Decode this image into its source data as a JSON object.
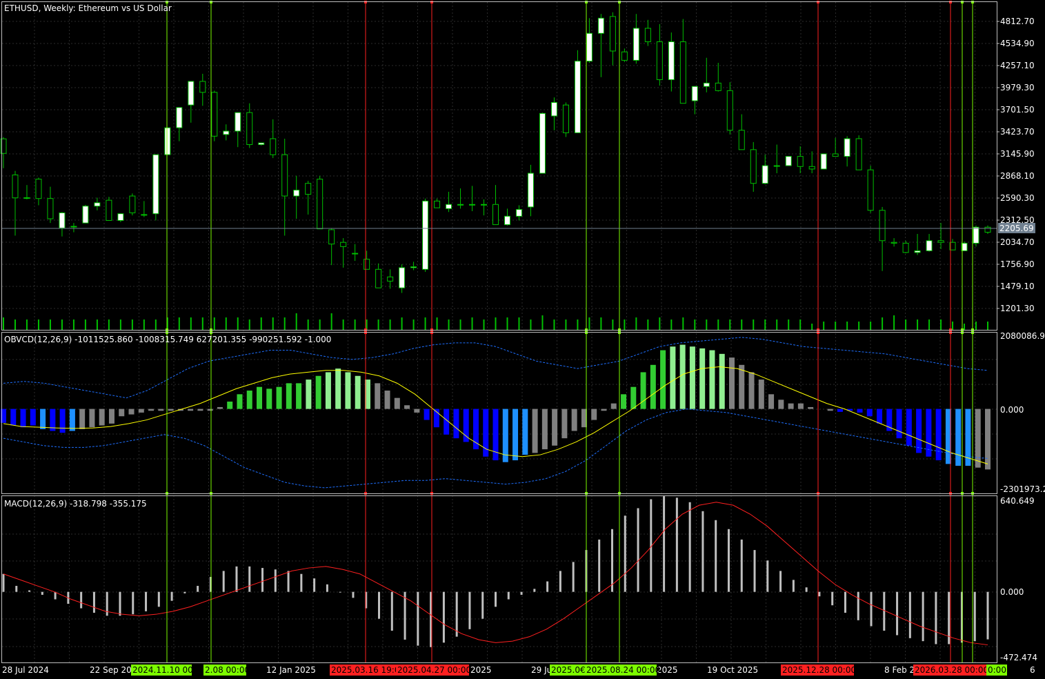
{
  "window": {
    "title": "ETHUSD, Weekly:  Ethereum vs US Dollar",
    "current_price": "2205.69"
  },
  "colors": {
    "background": "#000000",
    "grid": "#c0c0c0",
    "text": "#ffffff",
    "axis": "#c0c0c0",
    "bull_candle": "#ffffff",
    "bear_candle": "#000000",
    "wick": "#00c000",
    "volume": "#00c000",
    "buy_line": "#7cfc00",
    "sell_line": "#ff2020",
    "price_line": "#708090",
    "obv_bright_green": "#32cd32",
    "obv_light_green": "#90ee90",
    "obv_gray": "#808080",
    "obv_blue": "#0000ff",
    "obv_light_blue": "#1e90ff",
    "obv_signal": "#ffff00",
    "obv_band": "#1e6fff",
    "macd_hist": "#c0c0c0",
    "macd_signal": "#ff2020"
  },
  "price_axis": {
    "labels": [
      "4812.70",
      "4534.90",
      "4257.10",
      "3979.30",
      "3701.50",
      "3423.70",
      "3145.90",
      "2868.10",
      "2590.30",
      "2312.50",
      "2034.70",
      "1756.90",
      "1479.10",
      "1201.30"
    ]
  },
  "obvcd": {
    "label": "OBVCD(12,26,9) -1011525.860 -1008315.749 627201.355 -990251.592 -1.000",
    "axis_top": "2080086.98",
    "axis_zero": "0.000",
    "axis_bottom": "-2301973.2"
  },
  "macd": {
    "label": "MACD(12,26,9) -318.798 -355.175",
    "axis_top": "640.649",
    "axis_zero": "0.000",
    "axis_bottom": "-472.474"
  },
  "time_axis": {
    "labels": [
      "28 Jul 2024",
      "22 Sep 20",
      "12 Jan 2025",
      "2025",
      "29 Ju",
      "2025",
      "19 Oct 2025",
      "8 Feb 2",
      "6"
    ],
    "tags": [
      {
        "text": "2024.11.10 00:00",
        "type": "buy"
      },
      {
        "text": "2.08 00:00",
        "type": "buy"
      },
      {
        "text": "2025.03.16 19:0",
        "type": "sell"
      },
      {
        "text": "2025.04.27 00:00",
        "type": "sell"
      },
      {
        "text": "2025.0€",
        "type": "buy"
      },
      {
        "text": "2025.08.24 00:00",
        "type": "buy"
      },
      {
        "text": "2025.12.28 00:00",
        "type": "sell"
      },
      {
        "text": "2026.03.28 00:00",
        "type": "sell"
      },
      {
        "text": "0:00",
        "type": "buy"
      }
    ]
  },
  "chart_data": [
    {
      "type": "candlestick",
      "title": "ETHUSD, Weekly:  Ethereum vs US Dollar",
      "ylim": [
        1062,
        4951
      ],
      "ohlc": [
        [
          3328,
          3348,
          2980,
          3156
        ],
        [
          2900,
          2948,
          2180,
          2628
        ],
        [
          2628,
          2780,
          2610,
          2630
        ],
        [
          2850,
          2868,
          2540,
          2620
        ],
        [
          2620,
          2760,
          2330,
          2380
        ],
        [
          2270,
          2460,
          2170,
          2450
        ],
        [
          2290,
          2330,
          2220,
          2290
        ],
        [
          2330,
          2545,
          2330,
          2530
        ],
        [
          2530,
          2630,
          2480,
          2570
        ],
        [
          2600,
          2640,
          2370,
          2360
        ],
        [
          2360,
          2425,
          2340,
          2440
        ],
        [
          2650,
          2680,
          2420,
          2450
        ],
        [
          2430,
          2590,
          2400,
          2430
        ],
        [
          2440,
          3140,
          2360,
          3140
        ],
        [
          3140,
          3230,
          3140,
          3460
        ],
        [
          3460,
          3680,
          3300,
          3700
        ],
        [
          3730,
          3980,
          3520,
          4010
        ],
        [
          4010,
          4100,
          3720,
          3880
        ],
        [
          3880,
          3900,
          3300,
          3360
        ],
        [
          3380,
          3500,
          3310,
          3420
        ],
        [
          3420,
          3630,
          3230,
          3640
        ],
        [
          3640,
          3750,
          3220,
          3260
        ],
        [
          3260,
          3270,
          3250,
          3280
        ],
        [
          3330,
          3560,
          3100,
          3140
        ],
        [
          3140,
          3330,
          2180,
          2650
        ],
        [
          2650,
          2890,
          2380,
          2720
        ],
        [
          2800,
          2830,
          2430,
          2670
        ],
        [
          2850,
          2890,
          2520,
          2260
        ],
        [
          2250,
          2270,
          1830,
          2080
        ],
        [
          2100,
          2150,
          1800,
          2050
        ],
        [
          1970,
          2080,
          1880,
          1970
        ],
        [
          1900,
          2000,
          1840,
          1780
        ],
        [
          1780,
          1850,
          1640,
          1560
        ],
        [
          1690,
          1780,
          1550,
          1640
        ],
        [
          1560,
          1840,
          1500,
          1800
        ],
        [
          1800,
          1870,
          1770,
          1810
        ],
        [
          1780,
          2620,
          1750,
          2590
        ],
        [
          2590,
          2620,
          2510,
          2510
        ],
        [
          2500,
          2700,
          2460,
          2550
        ],
        [
          2550,
          2740,
          2500,
          2550
        ],
        [
          2550,
          2770,
          2470,
          2550
        ],
        [
          2550,
          2610,
          2420,
          2550
        ],
        [
          2550,
          2780,
          2350,
          2310
        ],
        [
          2310,
          2500,
          2300,
          2410
        ],
        [
          2410,
          2540,
          2360,
          2490
        ],
        [
          2520,
          3020,
          2410,
          2920
        ],
        [
          2920,
          3640,
          3000,
          3630
        ],
        [
          3600,
          3820,
          3430,
          3760
        ],
        [
          3730,
          3760,
          3350,
          3400
        ],
        [
          3400,
          4380,
          3410,
          4250
        ],
        [
          4250,
          4760,
          4230,
          4580
        ],
        [
          4580,
          4810,
          4060,
          4760
        ],
        [
          4780,
          4830,
          4200,
          4370
        ],
        [
          4360,
          4400,
          4240,
          4260
        ],
        [
          4260,
          4810,
          4220,
          4640
        ],
        [
          4640,
          4740,
          4430,
          4480
        ],
        [
          4480,
          4690,
          3960,
          4030
        ],
        [
          4030,
          4590,
          3890,
          4480
        ],
        [
          4480,
          4750,
          4050,
          3750
        ],
        [
          3780,
          3790,
          3620,
          3950
        ],
        [
          3950,
          4290,
          3880,
          3990
        ],
        [
          3990,
          4230,
          3890,
          3900
        ],
        [
          3900,
          4000,
          3380,
          3430
        ],
        [
          3430,
          3620,
          3280,
          3200
        ],
        [
          3200,
          3290,
          2700,
          2800
        ],
        [
          2800,
          3140,
          2790,
          3010
        ],
        [
          3010,
          3260,
          2920,
          3010
        ],
        [
          3010,
          3120,
          3020,
          3120
        ],
        [
          3120,
          3240,
          2920,
          3000
        ],
        [
          3000,
          3180,
          2920,
          2970
        ],
        [
          2970,
          3140,
          3000,
          3150
        ],
        [
          3150,
          3340,
          3130,
          3120
        ],
        [
          3120,
          3360,
          3000,
          3330
        ],
        [
          3330,
          3370,
          3090,
          2960
        ],
        [
          2960,
          3010,
          2450,
          2480
        ],
        [
          2480,
          2520,
          1760,
          2120
        ],
        [
          2100,
          2150,
          2050,
          2090
        ],
        [
          2090,
          2120,
          1970,
          1980
        ],
        [
          1980,
          2200,
          1950,
          2000
        ],
        [
          2000,
          2200,
          1990,
          2120
        ],
        [
          2120,
          2330,
          2020,
          2100
        ],
        [
          2100,
          2140,
          2010,
          2010
        ],
        [
          2000,
          2110,
          2010,
          2090
        ],
        [
          2090,
          2300,
          2050,
          2280
        ],
        [
          2280,
          2300,
          2200,
          2220
        ]
      ],
      "volume_relative": [
        0.6,
        0.5,
        0.5,
        0.5,
        0.5,
        0.5,
        0.5,
        0.5,
        0.5,
        0.5,
        0.5,
        0.5,
        0.5,
        0.5,
        0.6,
        0.6,
        0.6,
        0.6,
        0.6,
        0.6,
        0.6,
        0.5,
        0.6,
        0.6,
        0.6,
        0.8,
        0.5,
        0.5,
        0.8,
        0.5,
        0.5,
        0.5,
        0.5,
        0.5,
        0.6,
        0.5,
        0.6,
        0.6,
        0.5,
        0.5,
        0.6,
        0.5,
        0.6,
        0.6,
        0.6,
        0.5,
        0.7,
        0.5,
        0.5,
        0.5,
        0.6,
        0.6,
        0.5,
        0.5,
        0.6,
        0.5,
        0.6,
        0.5,
        0.6,
        0.5,
        0.5,
        0.5,
        0.5,
        0.5,
        0.5,
        0.5,
        0.5,
        0.5,
        0.5,
        0.3,
        0.4,
        0.4,
        0.4,
        0.4,
        0.4,
        0.6,
        0.7,
        0.5,
        0.5,
        0.5,
        0.5,
        0.4,
        0.3,
        0.4,
        0.4,
        0.4,
        0.3
      ]
    },
    {
      "type": "bar",
      "title": "OBVCD(12,26,9)",
      "ylim": [
        -2301973,
        2080087
      ],
      "histogram": [
        -380000,
        -450000,
        -500000,
        -450000,
        -550000,
        -600000,
        -650000,
        -600000,
        -550000,
        -500000,
        -450000,
        -400000,
        -200000,
        -150000,
        -100000,
        -50000,
        -50000,
        -50000,
        -50000,
        -50000,
        -50000,
        -50000,
        50000,
        200000,
        400000,
        500000,
        600000,
        550000,
        600000,
        700000,
        700000,
        800000,
        900000,
        1000000,
        1100000,
        1000000,
        900000,
        800000,
        700000,
        500000,
        300000,
        100000,
        -100000,
        -300000,
        -500000,
        -700000,
        -800000,
        -900000,
        -1100000,
        -1300000,
        -1400000,
        -1450000,
        -1400000,
        -1250000,
        -1200000,
        -1100000,
        -1000000,
        -800000,
        -600000,
        -500000,
        -300000,
        -50000,
        150000,
        400000,
        600000,
        1000000,
        1200000,
        1600000,
        1700000,
        1750000,
        1700000,
        1650000,
        1600000,
        1500000,
        1400000,
        1200000,
        1000000,
        800000,
        400000,
        250000,
        150000,
        150000,
        50000,
        0,
        -50000,
        -80000,
        -50000,
        -100000,
        -200000,
        -400000,
        -600000,
        -800000,
        -1000000,
        -1200000,
        -1300000,
        -1400000,
        -1500000,
        -1550000,
        -1550000,
        -1600000,
        -1650000
      ],
      "histogram_colors": [
        "b",
        "b",
        "b",
        "b",
        "lb",
        "b",
        "b",
        "lb",
        "g",
        "g",
        "g",
        "g",
        "g",
        "g",
        "g",
        "g",
        "g",
        "g",
        "g",
        "g",
        "g",
        "g",
        "g",
        "B",
        "B",
        "B",
        "B",
        "B",
        "B",
        "B",
        "B",
        "L",
        "B",
        "L",
        "L",
        "L",
        "L",
        "L",
        "g",
        "g",
        "g",
        "g",
        "g",
        "b",
        "b",
        "b",
        "b",
        "b",
        "b",
        "b",
        "b",
        "lb",
        "lb",
        "lb",
        "g",
        "g",
        "g",
        "g",
        "g",
        "g",
        "g",
        "g",
        "g",
        "B",
        "B",
        "B",
        "B",
        "B",
        "L",
        "L",
        "L",
        "L",
        "L",
        "L",
        "g",
        "g",
        "g",
        "g",
        "g",
        "g",
        "g",
        "g",
        "g",
        "g",
        "g",
        "b",
        "b",
        "b",
        "b",
        "b",
        "b",
        "b",
        "b",
        "b",
        "b",
        "b",
        "lb",
        "lb",
        "lb"
      ],
      "signal": [
        -400000,
        -480000,
        -500000,
        -520000,
        -530000,
        -520000,
        -480000,
        -400000,
        -300000,
        -150000,
        0,
        150000,
        350000,
        550000,
        700000,
        850000,
        950000,
        1000000,
        1050000,
        1050000,
        1000000,
        900000,
        700000,
        400000,
        0,
        -400000,
        -800000,
        -1100000,
        -1250000,
        -1300000,
        -1250000,
        -1100000,
        -900000,
        -650000,
        -350000,
        -50000,
        300000,
        650000,
        950000,
        1100000,
        1150000,
        1100000,
        950000,
        750000,
        550000,
        350000,
        150000,
        0,
        -200000,
        -400000,
        -600000,
        -800000,
        -1000000,
        -1200000,
        -1350000,
        -1500000
      ],
      "band_upper": [
        700000,
        750000,
        700000,
        600000,
        500000,
        400000,
        300000,
        500000,
        800000,
        1100000,
        1300000,
        1400000,
        1500000,
        1600000,
        1600000,
        1500000,
        1400000,
        1350000,
        1400000,
        1500000,
        1650000,
        1750000,
        1800000,
        1800000,
        1700000,
        1500000,
        1300000,
        1200000,
        1100000,
        1200000,
        1300000,
        1500000,
        1700000,
        1800000,
        1850000,
        1900000,
        1950000,
        1900000,
        1800000,
        1700000,
        1650000,
        1600000,
        1550000,
        1500000,
        1400000,
        1300000,
        1200000,
        1100000,
        1050000
      ],
      "band_lower": [
        -800000,
        -900000,
        -1000000,
        -1050000,
        -1050000,
        -1000000,
        -900000,
        -800000,
        -700000,
        -800000,
        -1000000,
        -1300000,
        -1600000,
        -1800000,
        -2000000,
        -2100000,
        -2150000,
        -2100000,
        -2050000,
        -2000000,
        -1950000,
        -1950000,
        -1900000,
        -1950000,
        -2000000,
        -2050000,
        -2000000,
        -1900000,
        -1700000,
        -1400000,
        -1000000,
        -600000,
        -300000,
        -100000,
        0,
        -50000,
        -100000,
        -200000,
        -300000,
        -400000,
        -500000,
        -600000,
        -700000,
        -800000,
        -900000,
        -1000000,
        -1100000,
        -1200000,
        -1300000,
        -1350000
      ],
      "series": [
        {
          "name": "OBVCD(12,26,9)",
          "values": [
            -1011525.86
          ]
        },
        {
          "name": "",
          "values": [
            -1008315.749
          ]
        },
        {
          "name": "",
          "values": [
            627201.355
          ]
        },
        {
          "name": "",
          "values": [
            -990251.592
          ]
        },
        {
          "name": "",
          "values": [
            -1.0
          ]
        }
      ]
    },
    {
      "type": "bar",
      "title": "MACD(12,26,9)",
      "ylim": [
        -472.474,
        640.649
      ],
      "histogram": [
        120,
        40,
        10,
        -20,
        -50,
        -80,
        -110,
        -140,
        -160,
        -160,
        -150,
        -130,
        -100,
        -60,
        -10,
        40,
        100,
        140,
        170,
        170,
        160,
        150,
        140,
        120,
        90,
        50,
        0,
        -40,
        -110,
        -180,
        -260,
        -320,
        -360,
        -370,
        -340,
        -300,
        -250,
        -180,
        -100,
        -50,
        -20,
        20,
        70,
        140,
        200,
        280,
        350,
        420,
        510,
        560,
        620,
        640,
        630,
        600,
        540,
        480,
        420,
        350,
        280,
        210,
        140,
        80,
        30,
        -30,
        -90,
        -140,
        -190,
        -230,
        -260,
        -290,
        -310,
        -330,
        -350,
        -350,
        -340,
        -330,
        -318
      ],
      "signal": [
        120,
        80,
        40,
        0,
        -50,
        -90,
        -130,
        -150,
        -160,
        -150,
        -130,
        -100,
        -60,
        -20,
        20,
        60,
        100,
        140,
        160,
        170,
        150,
        120,
        60,
        0,
        -60,
        -140,
        -220,
        -280,
        -320,
        -340,
        -330,
        -300,
        -250,
        -180,
        -100,
        -20,
        60,
        160,
        280,
        420,
        520,
        580,
        600,
        580,
        520,
        440,
        340,
        240,
        140,
        50,
        -20,
        -80,
        -130,
        -180,
        -230,
        -270,
        -310,
        -340,
        -355
      ],
      "series": [
        {
          "name": "MACD(12,26,9)",
          "values": [
            -318.798
          ]
        },
        {
          "name": "",
          "values": [
            -355.175
          ]
        }
      ]
    }
  ]
}
